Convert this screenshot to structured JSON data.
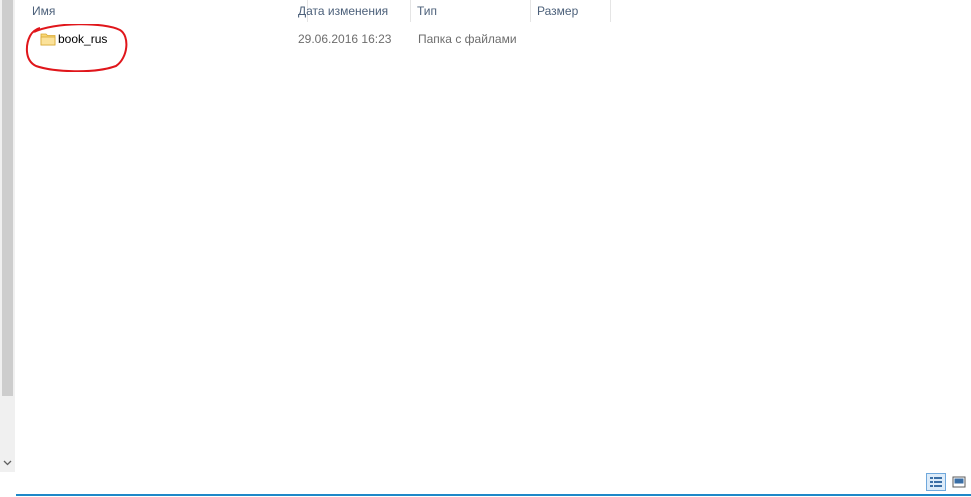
{
  "header": {
    "name_label": "Имя",
    "date_label": "Дата изменения",
    "type_label": "Тип",
    "size_label": "Размер"
  },
  "files": [
    {
      "name": "book_rus",
      "modified": "29.06.2016 16:23",
      "type": "Папка с файлами",
      "size": "",
      "icon": "folder-icon"
    }
  ],
  "annotation": {
    "color": "#e0161b",
    "target": "book_rus"
  },
  "view_buttons": [
    {
      "name": "details-view",
      "icon": "details-view-icon",
      "active": true
    },
    {
      "name": "tiles-view",
      "icon": "tiles-view-icon",
      "active": false
    }
  ],
  "colors": {
    "header_text": "#4c607a",
    "secondary_text": "#6d6d6d",
    "status_line": "#1e88c8"
  }
}
